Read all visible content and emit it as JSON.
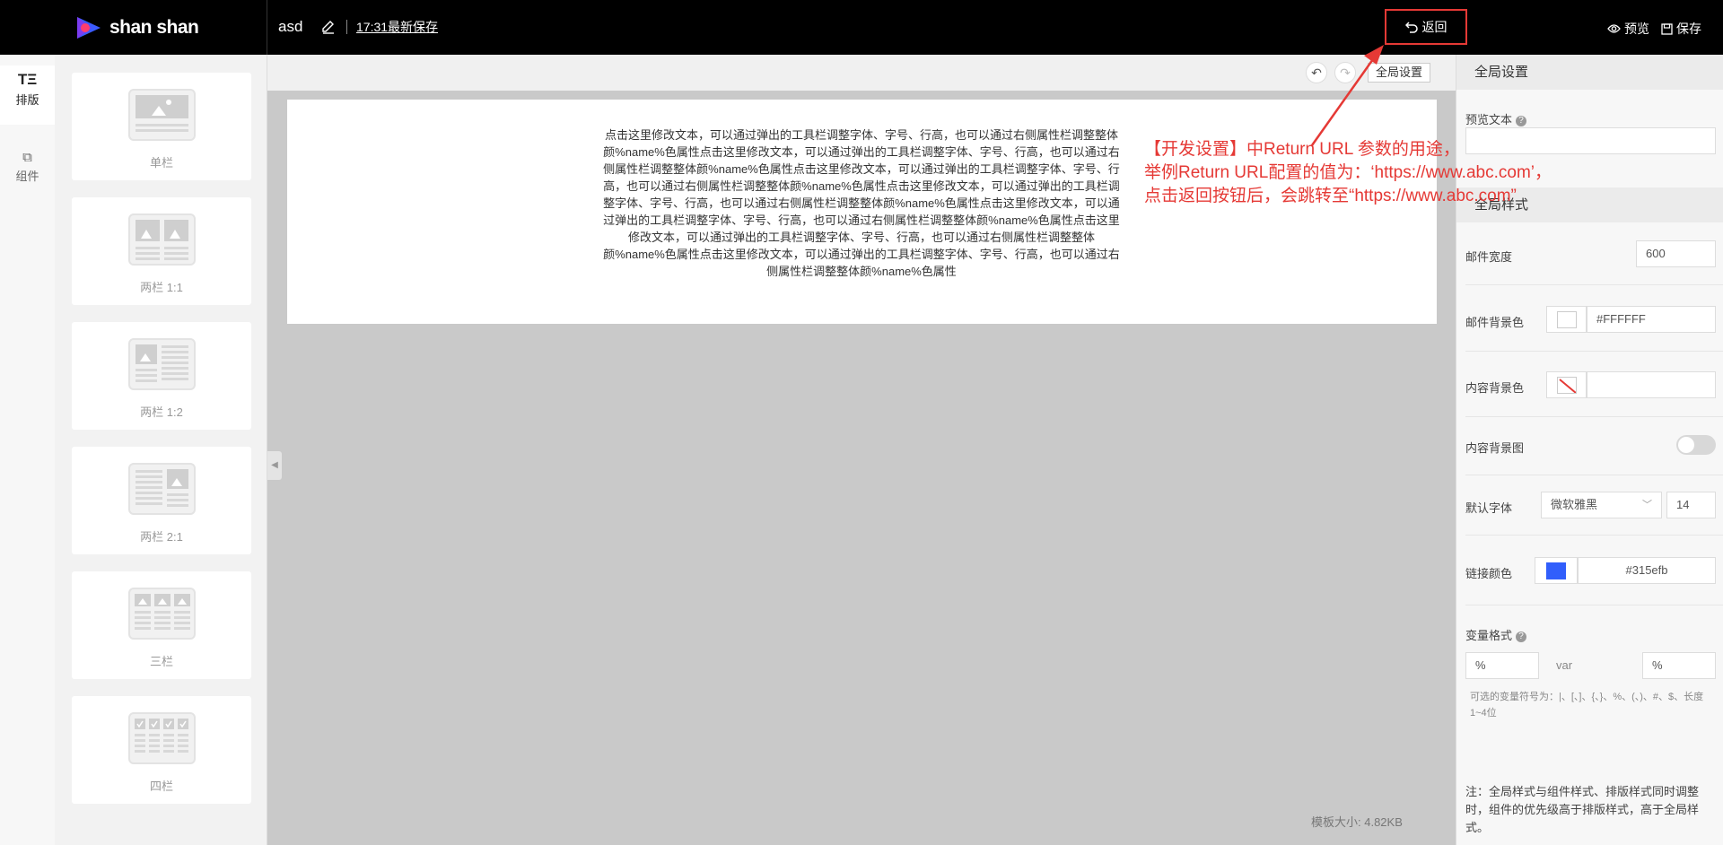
{
  "header": {
    "logo_text": "shan shan",
    "doc_title": "asd",
    "save_time": "17:31最新保存",
    "return_label": "返回",
    "preview_label": "预览",
    "save_label": "保存"
  },
  "left_nav": {
    "items": [
      {
        "icon": "TΞ",
        "label": "排版"
      },
      {
        "icon": "⧉",
        "label": "组件"
      }
    ]
  },
  "layouts": [
    {
      "label": "单栏"
    },
    {
      "label": "两栏 1:1"
    },
    {
      "label": "两栏 1:2"
    },
    {
      "label": "两栏 2:1"
    },
    {
      "label": "三栏"
    },
    {
      "label": "四栏"
    }
  ],
  "canvas": {
    "undo_icon": "↶",
    "redo_icon": "↷",
    "global_settings_btn": "全局设置",
    "email_text": "点击这里修改文本，可以通过弹出的工具栏调整字体、字号、行高，也可以通过右侧属性栏调整整体颜%name%色属性点击这里修改文本，可以通过弹出的工具栏调整字体、字号、行高，也可以通过右侧属性栏调整整体颜%name%色属性点击这里修改文本，可以通过弹出的工具栏调整字体、字号、行高，也可以通过右侧属性栏调整整体颜%name%色属性点击这里修改文本，可以通过弹出的工具栏调整字体、字号、行高，也可以通过右侧属性栏调整整体颜%name%色属性点击这里修改文本，可以通过弹出的工具栏调整字体、字号、行高，也可以通过右侧属性栏调整整体颜%name%色属性点击这里修改文本，可以通过弹出的工具栏调整字体、字号、行高，也可以通过右侧属性栏调整整体颜%name%色属性点击这里修改文本，可以通过弹出的工具栏调整字体、字号、行高，也可以通过右侧属性栏调整整体颜%name%色属性",
    "template_size": "模板大小: 4.82KB"
  },
  "right_panel": {
    "global_settings_title": "全局设置",
    "preview_text_label": "预览文本",
    "preview_text_value": "",
    "global_style_title": "全局样式",
    "mail_width_label": "邮件宽度",
    "mail_width_value": "600",
    "mail_bg_label": "邮件背景色",
    "mail_bg_value": "#FFFFFF",
    "content_bg_label": "内容背景色",
    "content_bg_value": "",
    "content_bg_image_label": "内容背景图",
    "default_font_label": "默认字体",
    "default_font_value": "微软雅黑",
    "default_font_size": "14",
    "link_color_label": "链接颜色",
    "link_color_value": "#315efb",
    "link_color_swatch": "#315efb",
    "var_format_label": "变量格式",
    "var_left": "%",
    "var_middle": "var",
    "var_right": "%",
    "var_hint": "可选的变量符号为：|、[、]、{、}、%、(、)、#、$、长度1~4位",
    "note": "注：全局样式与组件样式、排版样式同时调整时，组件的优先级高于排版样式，高于全局样式。"
  },
  "annotation": {
    "line1": "【开发设置】中Return URL 参数的用途，",
    "line2": "举例Return URL配置的值为：‘https://www.abc.com’，",
    "line3": "点击返回按钮后，会跳转至“https://www.abc.com”"
  }
}
